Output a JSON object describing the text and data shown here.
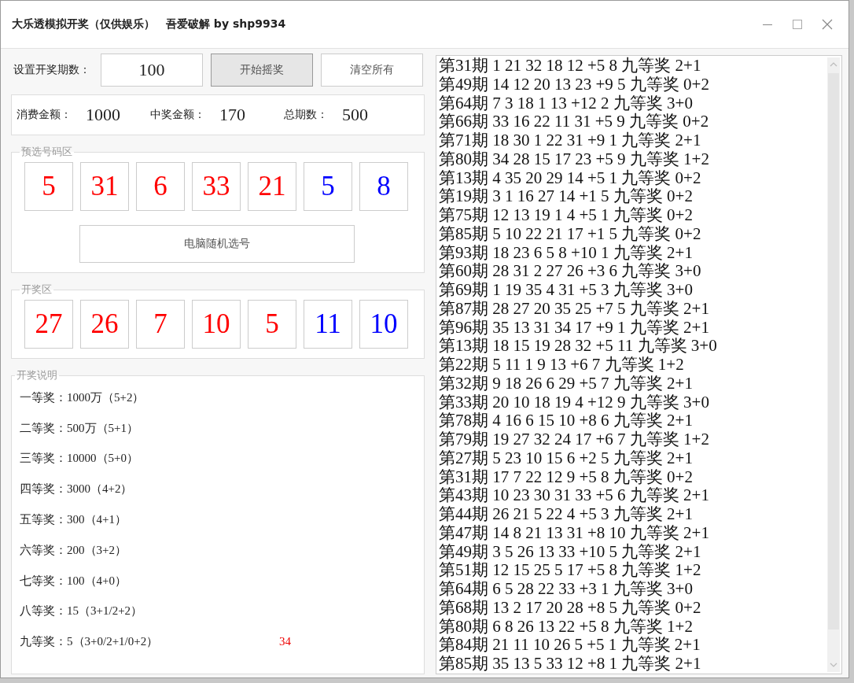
{
  "window": {
    "title": "大乐透模拟开奖（仅供娱乐）　吾爱破解 by shp9934"
  },
  "draw_count": {
    "label": "设置开奖期数：",
    "value": "100"
  },
  "buttons": [
    {
      "label": "开始摇奖",
      "pressed": true
    },
    {
      "label": "清空所有",
      "pressed": false
    }
  ],
  "stats": [
    {
      "label": "消费金额：",
      "value": "1000"
    },
    {
      "label": "中奖金额：",
      "value": "170"
    },
    {
      "label": "总期数：",
      "value": "500"
    }
  ],
  "preselect": {
    "title": "预选号码区",
    "balls": [
      {
        "number": "5",
        "kind": "front"
      },
      {
        "number": "31",
        "kind": "front"
      },
      {
        "number": "6",
        "kind": "front"
      },
      {
        "number": "33",
        "kind": "front"
      },
      {
        "number": "21",
        "kind": "front"
      },
      {
        "number": "5",
        "kind": "back"
      },
      {
        "number": "8",
        "kind": "back"
      }
    ],
    "button": "电脑随机选号"
  },
  "draw": {
    "title": "开奖区",
    "balls": [
      {
        "number": "27",
        "kind": "front"
      },
      {
        "number": "26",
        "kind": "front"
      },
      {
        "number": "7",
        "kind": "front"
      },
      {
        "number": "10",
        "kind": "front"
      },
      {
        "number": "5",
        "kind": "front"
      },
      {
        "number": "11",
        "kind": "back"
      },
      {
        "number": "10",
        "kind": "back"
      }
    ]
  },
  "prize_info": {
    "title": "开奖说明",
    "lines": [
      "一等奖：1000万（5+2）",
      "二等奖：500万（5+1）",
      "三等奖：10000（5+0）",
      "四等奖：3000（4+2）",
      "五等奖：300（4+1）",
      "六等奖：200（3+2）",
      "七等奖：100（4+0）",
      "八等奖：15（3+1/2+2）",
      "九等奖：5（3+0/2+1/0+2）"
    ],
    "note": "34"
  },
  "log": {
    "lines": [
      "第31期 1 21 32 18 12 +5 8 九等奖 2+1",
      "第49期 14 12 20 13 23 +9 5 九等奖 0+2",
      "第64期 7 3 18 1 13 +12 2 九等奖 3+0",
      "第66期 33 16 22 11 31 +5 9 九等奖 0+2",
      "第71期 18 30 1 22 31 +9 1 九等奖 2+1",
      "第80期 34 28 15 17 23 +5 9 九等奖 1+2",
      "第13期 4 35 20 29 14 +5 1 九等奖 0+2",
      "第19期 3 1 16 27 14 +1 5 九等奖 0+2",
      "第75期 12 13 19 1 4 +5 1 九等奖 0+2",
      "第85期 5 10 22 21 17 +1 5 九等奖 0+2",
      "第93期 18 23 6 5 8 +10 1 九等奖 2+1",
      "第60期 28 31 2 27 26 +3 6 九等奖 3+0",
      "第69期 1 19 35 4 31 +5 3 九等奖 3+0",
      "第87期 28 27 20 35 25 +7 5 九等奖 2+1",
      "第96期 35 13 31 34 17 +9 1 九等奖 2+1",
      "第13期 18 15 19 28 32 +5 11 九等奖 3+0",
      "第22期 5 11 1 9 13 +6 7 九等奖 1+2",
      "第32期 9 18 26 6 29 +5 7 九等奖 2+1",
      "第33期 20 10 18 19 4 +12 9 九等奖 3+0",
      "第78期 4 16 6 15 10 +8 6 九等奖 2+1",
      "第79期 19 27 32 24 17 +6 7 九等奖 1+2",
      "第27期 5 23 10 15 6 +2 5 九等奖 2+1",
      "第31期 17 7 22 12 9 +5 8 九等奖 0+2",
      "第43期 10 23 30 31 33 +5 6 九等奖 2+1",
      "第44期 26 21 5 22 4 +5 3 九等奖 2+1",
      "第47期 14 8 21 13 31 +8 10 九等奖 2+1",
      "第49期 3 5 26 13 33 +10 5 九等奖 2+1",
      "第51期 12 15 25 5 17 +5 8 九等奖 1+2",
      "第64期 6 5 28 22 33 +3 1 九等奖 3+0",
      "第68期 13 2 17 20 28 +8 5 九等奖 0+2",
      "第80期 6 8 26 13 22 +5 8 九等奖 1+2",
      "第84期 21 11 10 26 5 +5 1 九等奖 2+1",
      "第85期 35 13 5 33 12 +8 1 九等奖 2+1"
    ]
  }
}
